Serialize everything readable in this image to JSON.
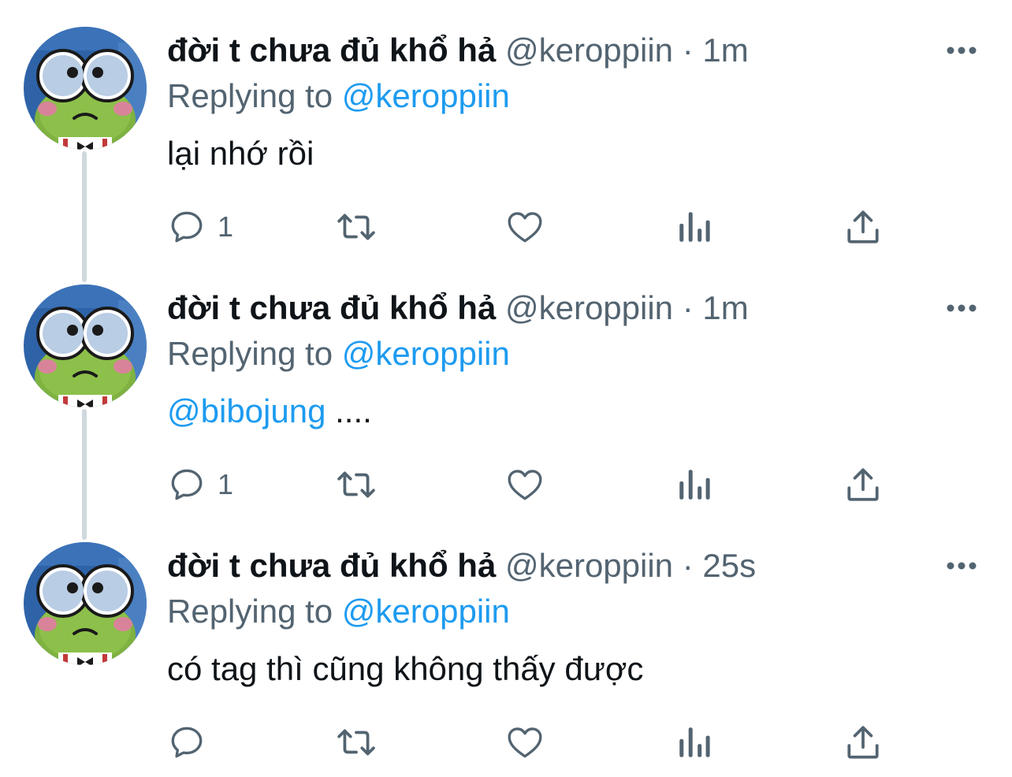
{
  "tweets": [
    {
      "author": {
        "name": "đời t chưa đủ khổ hả",
        "handle": "@keroppiin"
      },
      "separator": "·",
      "time": "1m",
      "replying_label": "Replying to",
      "replying_to": "@keroppiin",
      "mention": "",
      "text": "lại nhớ rồi",
      "reply_count": "1"
    },
    {
      "author": {
        "name": "đời t chưa đủ khổ hả",
        "handle": "@keroppiin"
      },
      "separator": "·",
      "time": "1m",
      "replying_label": "Replying to",
      "replying_to": "@keroppiin",
      "mention": "@bibojung",
      "text": " ....",
      "reply_count": "1"
    },
    {
      "author": {
        "name": "đời t chưa đủ khổ hả",
        "handle": "@keroppiin"
      },
      "separator": "·",
      "time": "25s",
      "replying_label": "Replying to",
      "replying_to": "@keroppiin",
      "mention": "",
      "text": "có tag thì cũng không thấy được",
      "reply_count": ""
    }
  ],
  "icons": {
    "more": "more-horizontal-icon",
    "reply": "reply-bubble-icon",
    "retweet": "retweet-arrows-icon",
    "like": "heart-icon",
    "views": "bar-chart-views-icon",
    "share": "share-upload-icon"
  },
  "colors": {
    "text": "#0f1419",
    "muted": "#536471",
    "link": "#1d9bf0",
    "thread_line": "#cfd9de",
    "icon": "#536471"
  }
}
